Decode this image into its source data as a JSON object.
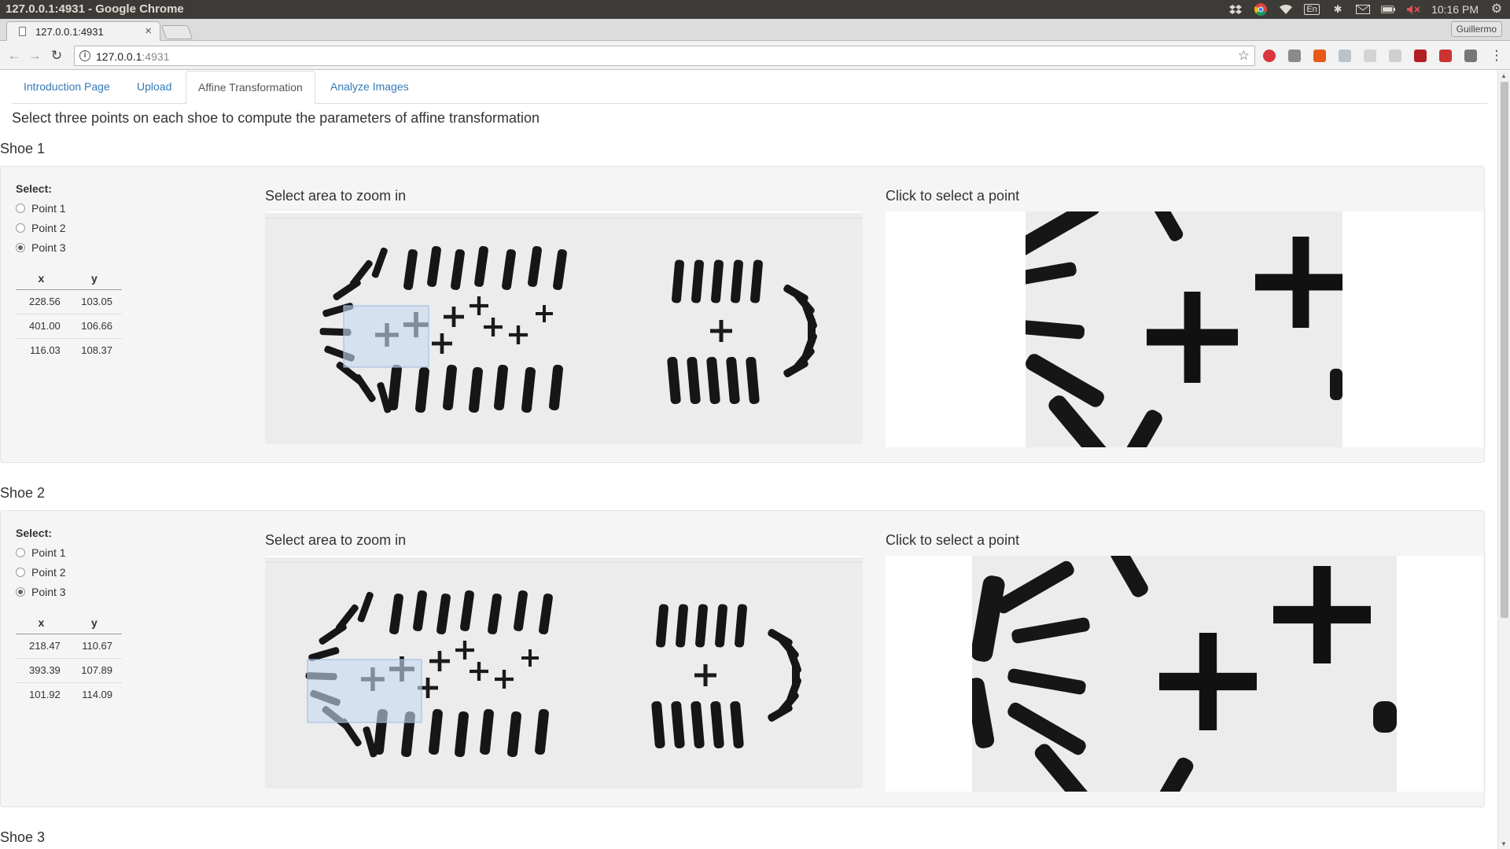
{
  "window": {
    "title": "127.0.0.1:4931 - Google Chrome",
    "time": "10:16 PM",
    "lang": "En"
  },
  "browser": {
    "tab_label": "127.0.0.1:4931",
    "url_host": "127.0.0.1",
    "url_port": ":4931",
    "profile": "Guillermo"
  },
  "nav_tabs": [
    "Introduction Page",
    "Upload",
    "Affine Transformation",
    "Analyze Images"
  ],
  "active_tab": "Affine Transformation",
  "instructions": "Select three points on each shoe to compute the parameters of affine transformation",
  "shoes": [
    {
      "title": "Shoe 1",
      "select_label": "Select:",
      "points": [
        "Point 1",
        "Point 2",
        "Point 3"
      ],
      "selected_point": "Point 3",
      "table_headers": [
        "x",
        "y"
      ],
      "rows": [
        [
          "228.56",
          "103.05"
        ],
        [
          "401.00",
          "106.66"
        ],
        [
          "116.03",
          "108.37"
        ]
      ],
      "zoom_label": "Select area to zoom in",
      "click_label": "Click to select a point"
    },
    {
      "title": "Shoe 2",
      "select_label": "Select:",
      "points": [
        "Point 1",
        "Point 2",
        "Point 3"
      ],
      "selected_point": "Point 3",
      "table_headers": [
        "x",
        "y"
      ],
      "rows": [
        [
          "218.47",
          "110.67"
        ],
        [
          "393.39",
          "107.89"
        ],
        [
          "101.92",
          "114.09"
        ]
      ],
      "zoom_label": "Select area to zoom in",
      "click_label": "Click to select a point"
    },
    {
      "title": "Shoe 3"
    }
  ],
  "colors": {
    "link": "#337ab7",
    "well": "#f5f5f5",
    "brush": "#c6daf2"
  },
  "icons": [
    "dropbox-icon",
    "chrome-icon",
    "wifi-icon",
    "keyboard-icon",
    "bluetooth-icon",
    "mail-icon",
    "battery-icon",
    "volume-muted-icon",
    "settings-icon",
    "back-icon",
    "forward-icon",
    "reload-icon",
    "info-icon",
    "star-icon",
    "menu-icon"
  ]
}
